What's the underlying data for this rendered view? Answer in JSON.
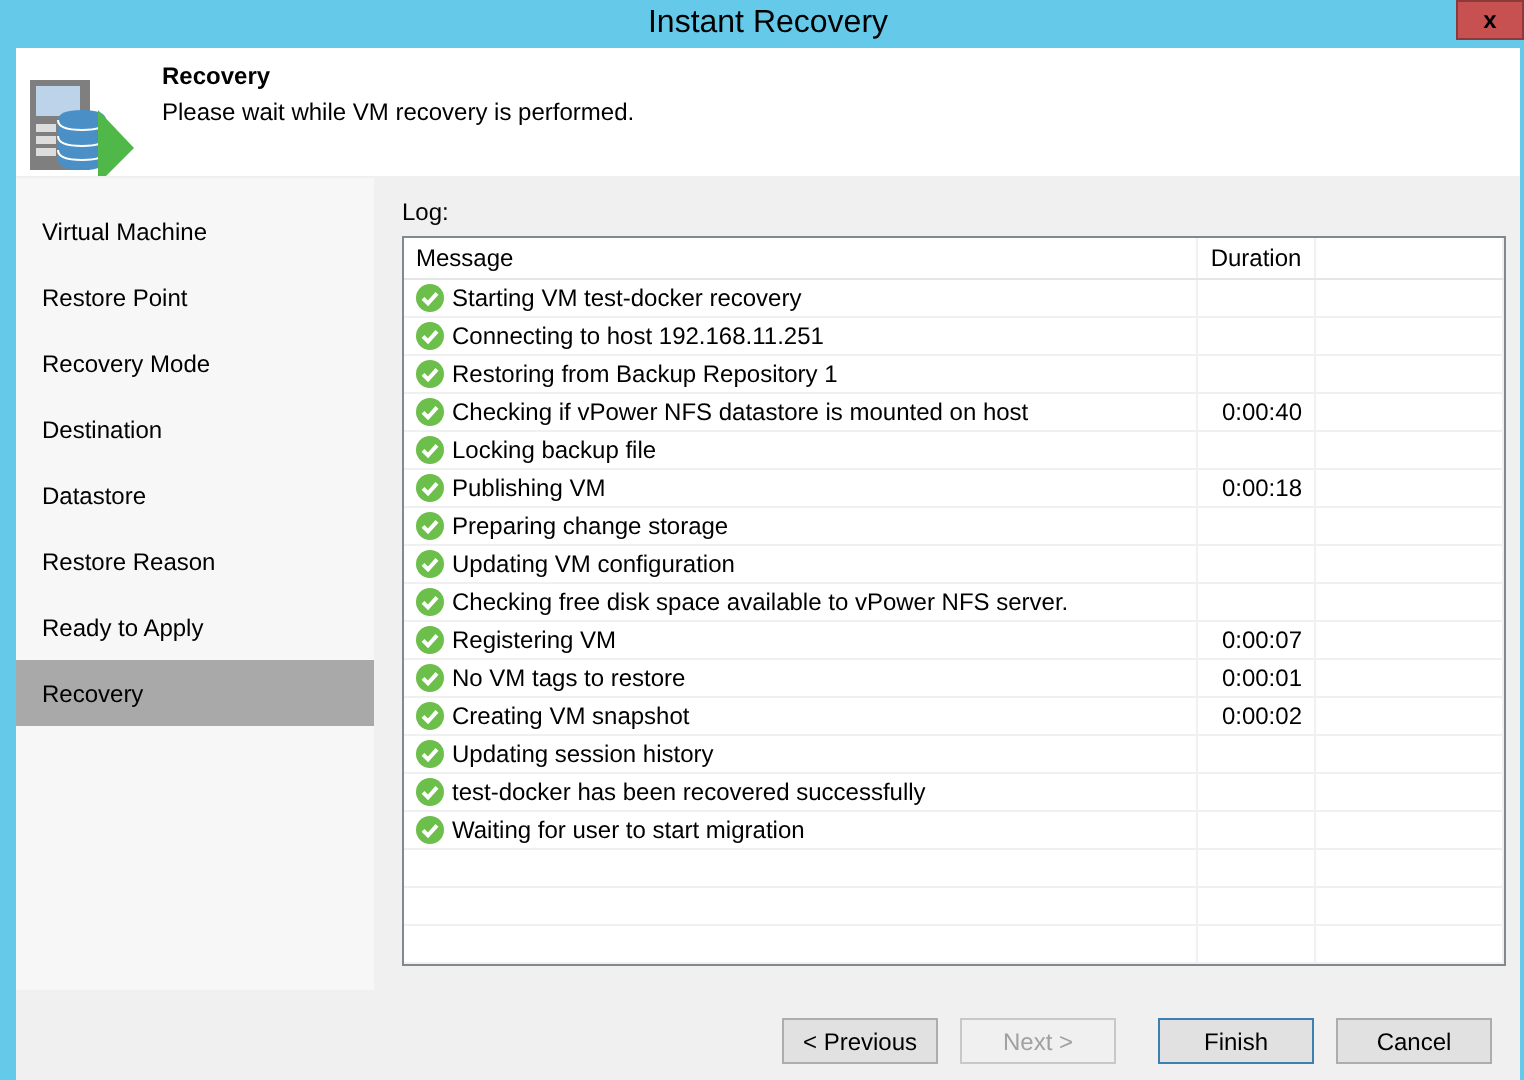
{
  "window": {
    "title": "Instant Recovery",
    "close": "x"
  },
  "header": {
    "title": "Recovery",
    "subtitle": "Please wait while VM recovery is performed."
  },
  "sidebar": {
    "items": [
      {
        "label": "Virtual Machine",
        "selected": false
      },
      {
        "label": "Restore Point",
        "selected": false
      },
      {
        "label": "Recovery Mode",
        "selected": false
      },
      {
        "label": "Destination",
        "selected": false
      },
      {
        "label": "Datastore",
        "selected": false
      },
      {
        "label": "Restore Reason",
        "selected": false
      },
      {
        "label": "Ready to Apply",
        "selected": false
      },
      {
        "label": "Recovery",
        "selected": true
      }
    ]
  },
  "log": {
    "label": "Log:",
    "columns": [
      "Message",
      "Duration"
    ],
    "rows": [
      {
        "message": "Starting VM test-docker recovery",
        "duration": "",
        "done": true
      },
      {
        "message": "Connecting to host 192.168.11.251",
        "duration": "",
        "done": true
      },
      {
        "message": "Restoring from Backup Repository 1",
        "duration": "",
        "done": true
      },
      {
        "message": "Checking if vPower NFS datastore is mounted on host",
        "duration": "0:00:40",
        "done": true
      },
      {
        "message": "Locking backup file",
        "duration": "",
        "done": true
      },
      {
        "message": "Publishing VM",
        "duration": "0:00:18",
        "done": true
      },
      {
        "message": "Preparing change storage",
        "duration": "",
        "done": true
      },
      {
        "message": "Updating VM configuration",
        "duration": "",
        "done": true
      },
      {
        "message": "Checking free disk space available to vPower NFS server.",
        "duration": "",
        "done": true
      },
      {
        "message": "Registering VM",
        "duration": "0:00:07",
        "done": true
      },
      {
        "message": "No VM tags to restore",
        "duration": "0:00:01",
        "done": true
      },
      {
        "message": "Creating VM snapshot",
        "duration": "0:00:02",
        "done": true
      },
      {
        "message": "Updating session history",
        "duration": "",
        "done": true
      },
      {
        "message": "test-docker has been recovered successfully",
        "duration": "",
        "done": true
      },
      {
        "message": "Waiting for user to start migration",
        "duration": "",
        "done": true
      }
    ]
  },
  "buttons": [
    {
      "label": "< Previous",
      "disabled": false,
      "default": false
    },
    {
      "label": "Next >",
      "disabled": true,
      "default": false
    },
    {
      "label": "Finish",
      "disabled": false,
      "default": true
    },
    {
      "label": "Cancel",
      "disabled": false,
      "default": false
    }
  ]
}
